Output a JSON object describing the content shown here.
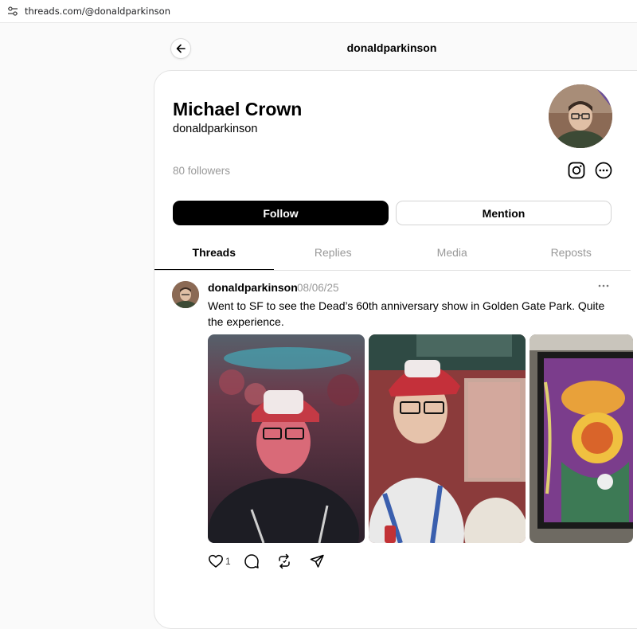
{
  "browser": {
    "url": "threads.com/@donaldparkinson"
  },
  "header": {
    "title": "donaldparkinson"
  },
  "profile": {
    "name": "Michael Crown",
    "handle": "donaldparkinson",
    "followers": "80 followers",
    "follow_label": "Follow",
    "mention_label": "Mention"
  },
  "tabs": [
    {
      "label": "Threads",
      "active": true
    },
    {
      "label": "Replies",
      "active": false
    },
    {
      "label": "Media",
      "active": false
    },
    {
      "label": "Reposts",
      "active": false
    }
  ],
  "post": {
    "username": "donaldparkinson",
    "date": "08/06/25",
    "text": "Went to SF to see the Dead’s 60th anniversary show in Golden Gate Park. Quite the experience.",
    "like_count": "1"
  },
  "colors": {
    "accent": "#000000",
    "muted": "#999999",
    "border": "#e3e3e3"
  },
  "icons": [
    "settings-icon",
    "back-arrow-icon",
    "instagram-icon",
    "more-icon",
    "heart-icon",
    "comment-icon",
    "repost-icon",
    "share-icon"
  ]
}
